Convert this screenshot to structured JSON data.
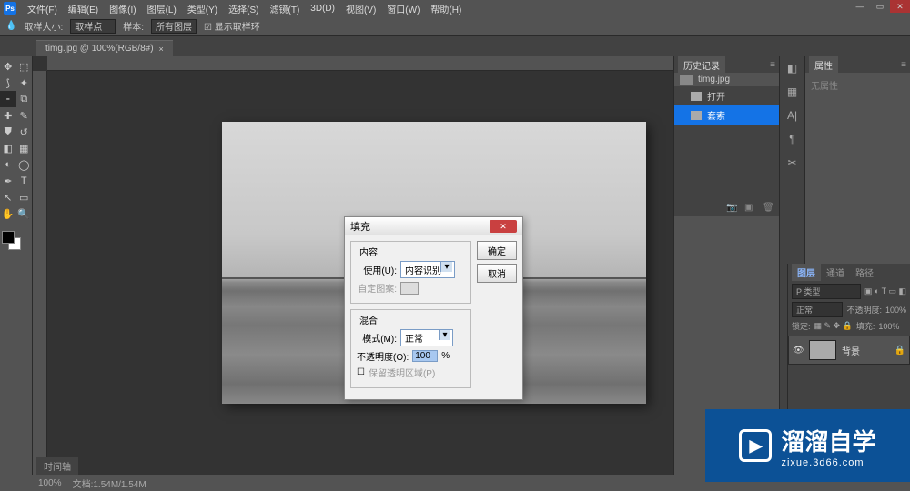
{
  "menu": {
    "items": [
      "文件(F)",
      "编辑(E)",
      "图像(I)",
      "图层(L)",
      "类型(Y)",
      "选择(S)",
      "滤镜(T)",
      "3D(D)",
      "视图(V)",
      "窗口(W)",
      "帮助(H)"
    ]
  },
  "options": {
    "label1": "取样大小:",
    "dd1": "取样点",
    "label2": "样本:",
    "dd2": "所有图层",
    "checkbox": "显示取样环"
  },
  "doc_tab": {
    "title": "timg.jpg @ 100%(RGB/8#)"
  },
  "dialog": {
    "title": "填充",
    "section1": "内容",
    "use_label": "使用(U):",
    "use_value": "内容识别",
    "custom_label": "自定图案:",
    "section2": "混合",
    "mode_label": "模式(M):",
    "mode_value": "正常",
    "opacity_label": "不透明度(O):",
    "opacity_value": "100",
    "opacity_unit": "%",
    "preserve_label": "保留透明区域(P)",
    "ok": "确定",
    "cancel": "取消"
  },
  "history": {
    "tab": "历史记录",
    "doc_name": "timg.jpg",
    "items": [
      {
        "label": "打开",
        "active": false
      },
      {
        "label": "套索",
        "active": true
      }
    ]
  },
  "props": {
    "tab": "属性",
    "body": "无属性"
  },
  "layers": {
    "tabs": [
      "图层",
      "通道",
      "路径"
    ],
    "kind_label": "P 类型",
    "blend": "正常",
    "opacity_label": "不透明度:",
    "opacity_value": "100%",
    "lock_label": "锁定:",
    "fill_label": "填充:",
    "fill_value": "100%",
    "layer_name": "背景"
  },
  "status": {
    "zoom": "100%",
    "info": "文档:1.54M/1.54M",
    "timeline": "时间轴"
  },
  "watermark": {
    "main": "溜溜自学",
    "sub": "zixue.3d66.com"
  }
}
